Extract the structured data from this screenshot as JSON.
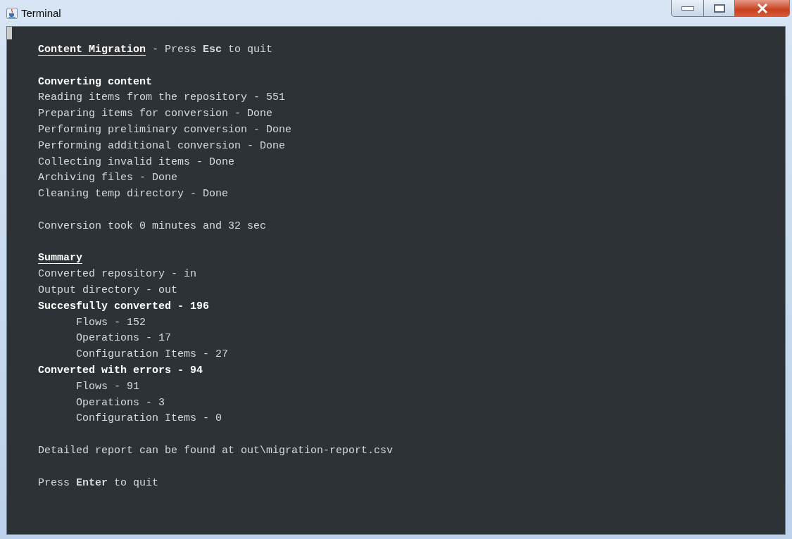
{
  "window": {
    "title": "Terminal"
  },
  "terminal": {
    "lines": [
      {
        "kind": "title",
        "title": "Content Migration",
        "text": "- Press **Esc** to quit"
      },
      {
        "kind": "blank"
      },
      {
        "kind": "heading",
        "text": "Converting content"
      },
      {
        "kind": "plain",
        "text": "Reading items from the repository - 551"
      },
      {
        "kind": "plain",
        "text": "Preparing items for conversion - Done"
      },
      {
        "kind": "plain",
        "text": "Performing preliminary conversion - Done"
      },
      {
        "kind": "plain",
        "text": "Performing additional conversion - Done"
      },
      {
        "kind": "plain",
        "text": "Collecting invalid items - Done"
      },
      {
        "kind": "plain",
        "text": "Archiving files - Done"
      },
      {
        "kind": "plain",
        "text": "Cleaning temp directory - Done"
      },
      {
        "kind": "blank"
      },
      {
        "kind": "plain",
        "text": "Conversion took 0 minutes and 32 sec"
      },
      {
        "kind": "blank"
      },
      {
        "kind": "underlined",
        "text": "Summary"
      },
      {
        "kind": "plain",
        "text": "Converted repository - in"
      },
      {
        "kind": "plain",
        "text": "Output directory - out"
      },
      {
        "kind": "heading",
        "text": "Succesfully converted - 196"
      },
      {
        "kind": "item",
        "text": "Flows - 152"
      },
      {
        "kind": "item",
        "text": "Operations - 17"
      },
      {
        "kind": "item",
        "text": "Configuration Items - 27"
      },
      {
        "kind": "heading",
        "text": "Converted with errors - 94"
      },
      {
        "kind": "item",
        "text": "Flows - 91"
      },
      {
        "kind": "item",
        "text": "Operations - 3"
      },
      {
        "kind": "item",
        "text": "Configuration Items - 0"
      },
      {
        "kind": "blank"
      },
      {
        "kind": "plain",
        "text": "Detailed report can be found at out\\migration-report.csv"
      },
      {
        "kind": "blank"
      },
      {
        "kind": "plain",
        "text": "Press **Enter** to quit"
      }
    ]
  }
}
